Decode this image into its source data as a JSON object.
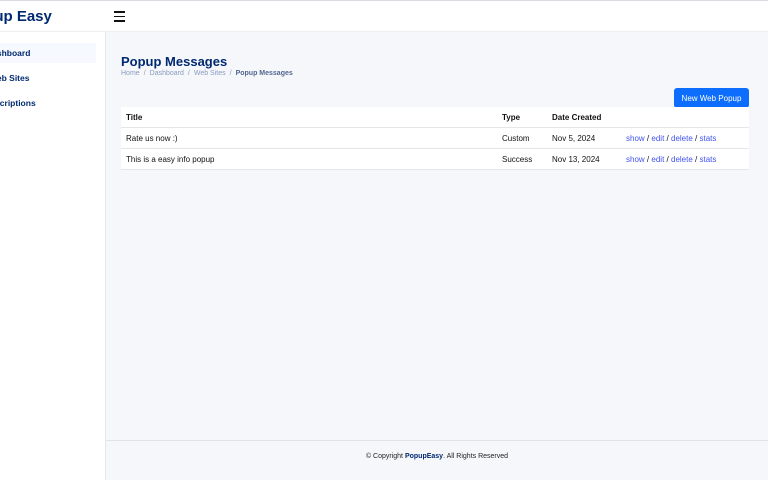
{
  "header": {
    "brand": "Popup Easy"
  },
  "sidebar": {
    "items": [
      {
        "label": "Dashboard"
      },
      {
        "label": "Web Sites"
      },
      {
        "label": "Subscriptions"
      }
    ]
  },
  "page": {
    "title": "Popup Messages",
    "breadcrumb": [
      "Home",
      "Dashboard",
      "Web Sites",
      "Popup Messages"
    ],
    "new_button": "New Web Popup"
  },
  "table": {
    "headers": {
      "title": "Title",
      "type": "Type",
      "date": "Date Created"
    },
    "rows": [
      {
        "title": "Rate us now :)",
        "type": "Custom",
        "date": "Nov 5, 2024"
      },
      {
        "title": "This is a easy info popup",
        "type": "Success",
        "date": "Nov 13, 2024"
      }
    ],
    "actions": {
      "show": "show",
      "edit": "edit",
      "delete": "delete",
      "stats": "stats",
      "sep": "/"
    }
  },
  "footer": {
    "prefix": "© Copyright",
    "brand": "PopupEasy",
    "suffix": ". All Rights Reserved"
  }
}
